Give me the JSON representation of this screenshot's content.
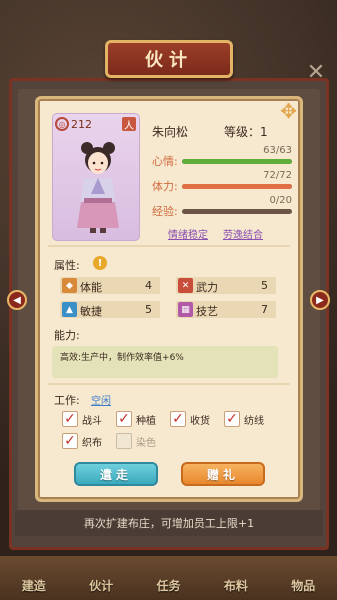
{
  "window_title": "伙计",
  "bottom_tip": "再次扩建布庄，可增加员工上限+1",
  "nav": [
    "建造",
    "伙计",
    "任务",
    "布料",
    "物品"
  ],
  "character": {
    "level_badge": "212",
    "role_badge": "人",
    "name": "朱向松",
    "level_text": "等级：1",
    "stats": [
      {
        "label": "心情:",
        "value": "63/63",
        "current": 63,
        "max": 63,
        "color": "#5fae3a"
      },
      {
        "label": "体力:",
        "value": "72/72",
        "current": 72,
        "max": 72,
        "color": "#e07043"
      },
      {
        "label": "经验:",
        "value": "0/20",
        "current": 0,
        "max": 20,
        "color": "#6a5546"
      }
    ],
    "tags": [
      "情绪稳定",
      "劳逸结合"
    ]
  },
  "attributes_label": "属性:",
  "attributes": [
    {
      "name": "体能",
      "value": "4",
      "icon": "strength-icon",
      "color": "#d9893a"
    },
    {
      "name": "武力",
      "value": "5",
      "icon": "sword-icon",
      "color": "#c84d3a"
    },
    {
      "name": "敏捷",
      "value": "5",
      "icon": "boot-icon",
      "color": "#3a8fc8"
    },
    {
      "name": "技艺",
      "value": "7",
      "icon": "scroll-icon",
      "color": "#b05aa8"
    }
  ],
  "ability_label": "能力:",
  "ability_text": "高效:生产中，制作效率值+6%",
  "work_label": "工作:",
  "work_status": "空闲",
  "work_options": [
    {
      "label": "战斗",
      "checked": true
    },
    {
      "label": "种植",
      "checked": true
    },
    {
      "label": "收货",
      "checked": true
    },
    {
      "label": "纺线",
      "checked": true
    },
    {
      "label": "织布",
      "checked": true
    },
    {
      "label": "染色",
      "checked": false
    }
  ],
  "buttons": {
    "dismiss": "遣走",
    "gift": "赠礼"
  },
  "nav_arrows": {
    "left": "◀",
    "right": "▶"
  }
}
